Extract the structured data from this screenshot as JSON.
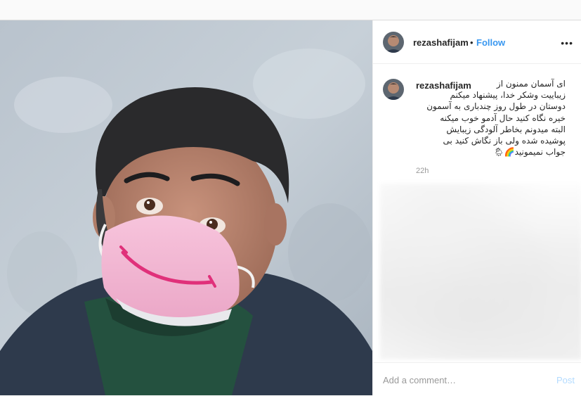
{
  "post": {
    "username": "rezashafijam",
    "follow_label": "Follow",
    "dot": "•",
    "more": "•••",
    "caption_username": "rezashafijam",
    "caption": "ای آسمان ممنون از\nزیباییت وشکر خدا، پیشنهاد میکنم\nدوستان در طول روز چندباری به آسمون\nخیره نگاه کنید حال آدمو خوب میکنه\nالبته میدونم بخاطر آلودگی زیبایش\nپوشیده شده ولی باز نگاش کنید بی\nجواب نمیمونید🌈🌦",
    "time": "22h",
    "comment_placeholder": "Add a comment…",
    "post_label": "Post"
  },
  "colors": {
    "link": "#3897f0",
    "post_disabled": "#b3dbff",
    "mask": "#f4b6d3",
    "smile": "#e0307a"
  }
}
